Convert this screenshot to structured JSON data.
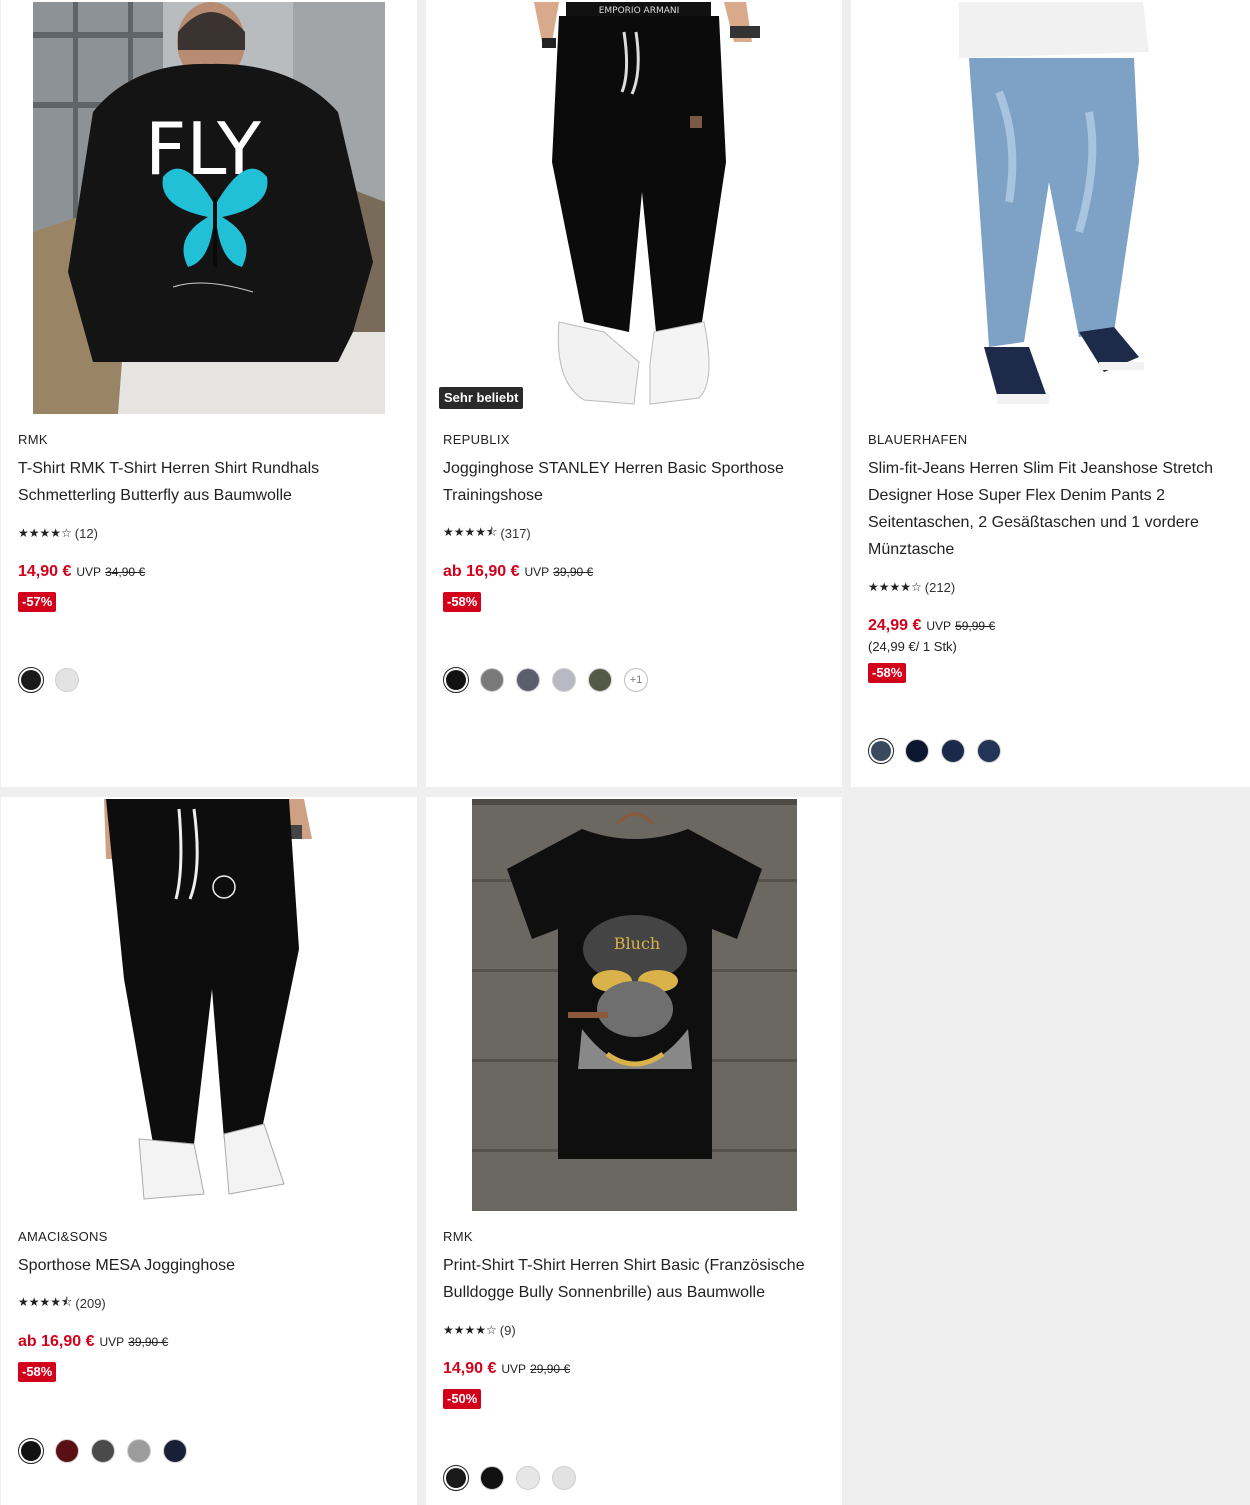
{
  "badges": {
    "popular": "Sehr beliebt"
  },
  "products": [
    {
      "brand": "RMK",
      "title": "T-Shirt RMK T-Shirt Herren Shirt Rundhals Schmetterling Butterfly aus Baumwolle",
      "stars": "★★★★☆",
      "reviews": "(12)",
      "price": "14,90 €",
      "uvp": "UVP",
      "old_price": "34,90 €",
      "discount": "-57%",
      "image_text": "FLY",
      "colors": [
        "#1a1a1a",
        "#e3e3e3"
      ]
    },
    {
      "brand": "REPUBLIX",
      "title": "Jogginghose STANLEY Herren Basic Sporthose Trainingshose",
      "stars": "★★★★⯪",
      "reviews": "(317)",
      "price": "ab 16,90 €",
      "uvp": "UVP",
      "old_price": "39,90 €",
      "discount": "-58%",
      "colors": [
        "#121212",
        "#7a7a7a",
        "#5c5e6c",
        "#b8b9c4",
        "#545a48"
      ],
      "more_colors": "+1"
    },
    {
      "brand": "BLAUERHAFEN",
      "title": "Slim-fit-Jeans Herren Slim Fit Jeanshose Stretch Designer Hose Super Flex Denim Pants 2 Seitentaschen, 2 Gesäßtaschen und 1 vordere Münztasche",
      "stars": "★★★★☆",
      "reviews": "(212)",
      "price": "24,99 €",
      "uvp": "UVP",
      "old_price": "59,99 €",
      "unit_price": "(24,99 €/ 1 Stk)",
      "discount": "-58%",
      "colors": [
        "#3a4a5e",
        "#0e1730",
        "#1b2a4a",
        "#223556"
      ]
    },
    {
      "brand": "AMACI&SONS",
      "title": "Sporthose MESA Jogginghose",
      "stars": "★★★★⯪",
      "reviews": "(209)",
      "price": "ab 16,90 €",
      "uvp": "UVP",
      "old_price": "39,90 €",
      "discount": "-58%",
      "colors": [
        "#111111",
        "#5a0f14",
        "#4a4a4a",
        "#9c9c9c",
        "#182038"
      ]
    },
    {
      "brand": "RMK",
      "title": "Print-Shirt T-Shirt Herren Shirt Basic (Französische Bulldogge Bully Sonnenbrille) aus Baumwolle",
      "stars": "★★★★☆",
      "reviews": "(9)",
      "price": "14,90 €",
      "uvp": "UVP",
      "old_price": "29,90 €",
      "discount": "-50%",
      "image_text": "Bluch",
      "colors": [
        "#1a1a1a",
        "#111111",
        "#e6e6e6",
        "#e2e2e2"
      ]
    }
  ]
}
